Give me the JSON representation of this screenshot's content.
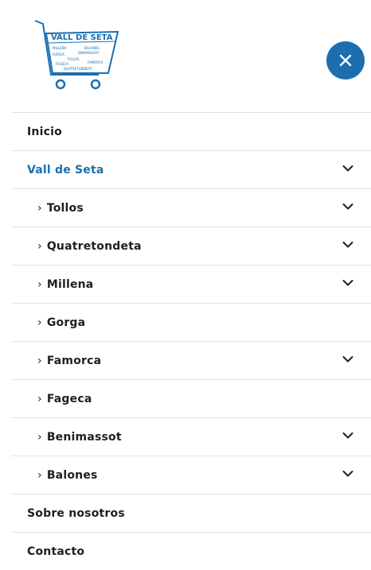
{
  "logo": {
    "title": "VALL DE SETA",
    "towns": [
      "MILLENA",
      "BALONES",
      "GORGA",
      "BENIMASSOT",
      "TOLLOS",
      "FAGECA",
      "FAMORCA",
      "QUATRETONDETA"
    ]
  },
  "close_icon": "close-icon",
  "colors": {
    "accent": "#1b6fb0",
    "divider": "#e3e3e3",
    "text": "#1f1f1f"
  },
  "menu": {
    "items": [
      {
        "label": "Inicio",
        "level": 0,
        "expandable": false,
        "active": false
      },
      {
        "label": "Vall de Seta",
        "level": 0,
        "expandable": true,
        "active": true
      },
      {
        "label": "Tollos",
        "level": 1,
        "expandable": true,
        "active": false
      },
      {
        "label": "Quatretondeta",
        "level": 1,
        "expandable": true,
        "active": false
      },
      {
        "label": "Millena",
        "level": 1,
        "expandable": true,
        "active": false
      },
      {
        "label": "Gorga",
        "level": 1,
        "expandable": false,
        "active": false
      },
      {
        "label": "Famorca",
        "level": 1,
        "expandable": true,
        "active": false
      },
      {
        "label": "Fageca",
        "level": 1,
        "expandable": false,
        "active": false
      },
      {
        "label": "Benimassot",
        "level": 1,
        "expandable": true,
        "active": false
      },
      {
        "label": "Balones",
        "level": 1,
        "expandable": true,
        "active": false
      },
      {
        "label": "Sobre nosotros",
        "level": 0,
        "expandable": false,
        "active": false
      },
      {
        "label": "Contacto",
        "level": 0,
        "expandable": false,
        "active": false
      }
    ]
  }
}
